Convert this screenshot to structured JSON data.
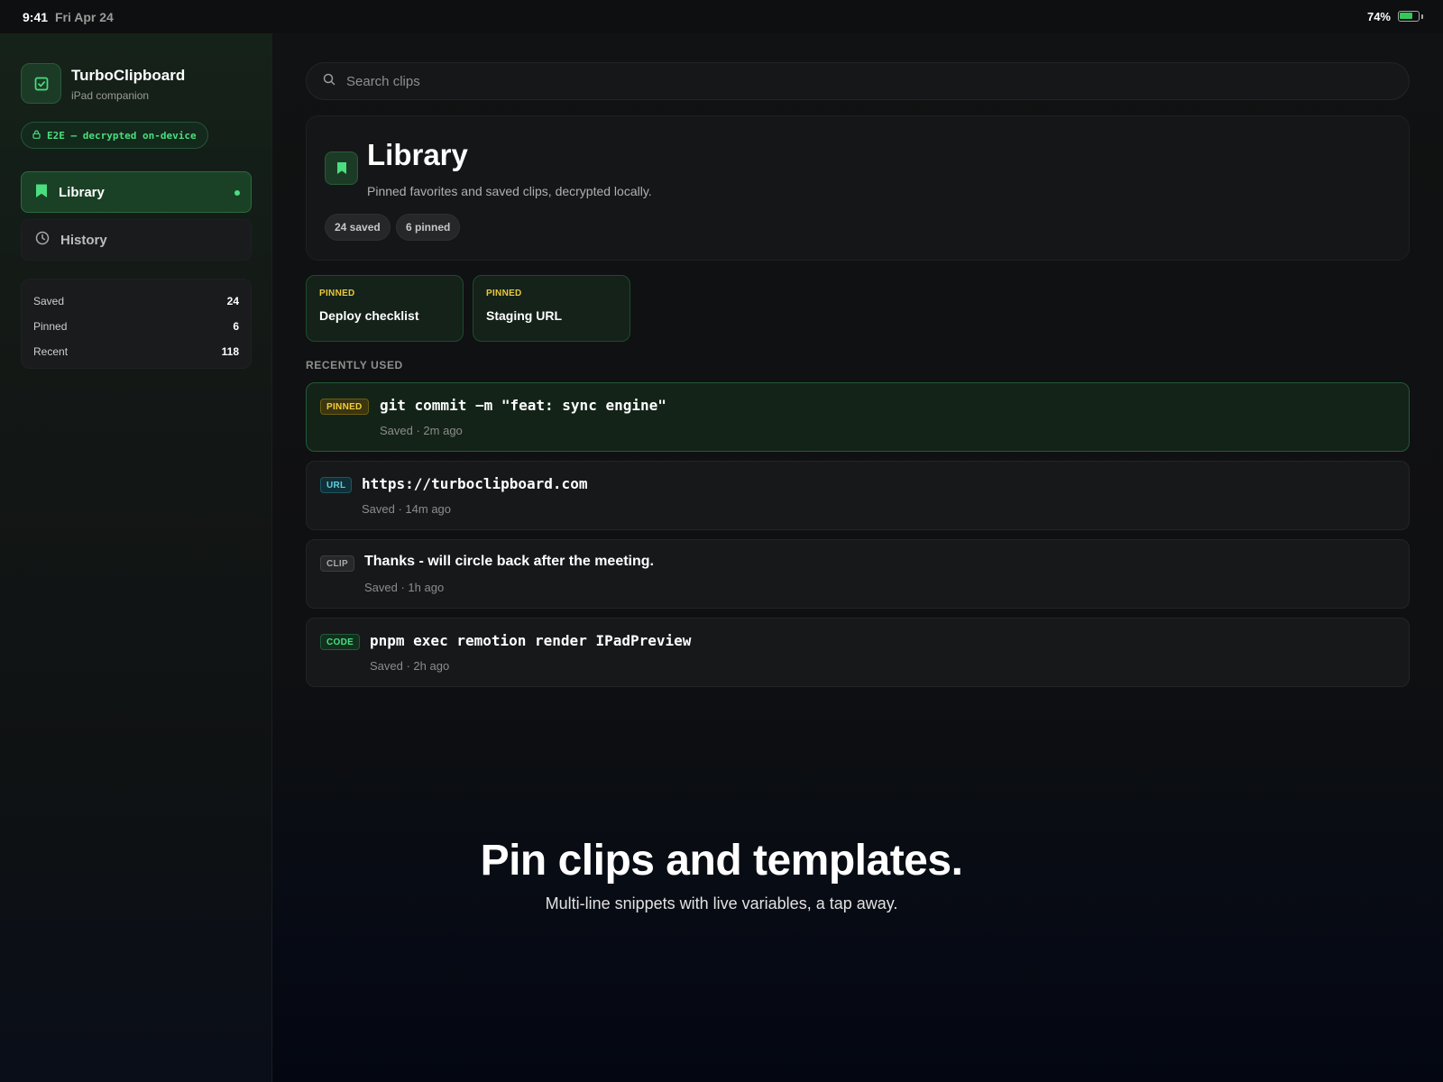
{
  "status_bar": {
    "time": "9:41",
    "date": "Fri Apr 24",
    "battery_text": "74%",
    "battery_level": 0.74,
    "battery_color": "#34c759"
  },
  "app": {
    "name": "TurboClipboard",
    "subtitle": "iPad companion",
    "icon": "clipboard-check-icon",
    "accent": "#4ade80"
  },
  "security_badge": {
    "label": "E2E — decrypted on-device",
    "icon": "lock-icon"
  },
  "sidebar": {
    "nav": [
      {
        "label": "Library",
        "icon": "bookmark-icon",
        "active": true
      },
      {
        "label": "History",
        "icon": "clock-icon",
        "active": false
      }
    ],
    "stats": [
      {
        "label": "Saved",
        "value": "24"
      },
      {
        "label": "Pinned",
        "value": "6"
      },
      {
        "label": "Recent",
        "value": "118"
      }
    ]
  },
  "search": {
    "placeholder": "Search clips",
    "icon": "search-icon"
  },
  "header": {
    "title": "Library",
    "subtitle": "Pinned favorites and saved clips, decrypted locally.",
    "icon": "bookmark-icon",
    "pills": [
      "24 saved",
      "6 pinned"
    ]
  },
  "pinned_cards": [
    {
      "tag": "PINNED",
      "title": "Deploy checklist"
    },
    {
      "tag": "PINNED",
      "title": "Staging URL"
    }
  ],
  "recent_section_label": "RECENTLY USED",
  "clips": [
    {
      "badge": "PINNED",
      "title": "git commit −m \"feat: sync engine\"",
      "meta": "Saved · 2m ago",
      "mono": true
    },
    {
      "badge": "URL",
      "title": "https://turboclipboard.com",
      "meta": "Saved · 14m ago",
      "mono": true
    },
    {
      "badge": "CLIP",
      "title": "Thanks - will circle back after the meeting.",
      "meta": "Saved · 1h ago",
      "mono": false
    },
    {
      "badge": "CODE",
      "title": "pnpm exec remotion render IPadPreview",
      "meta": "Saved · 2h ago",
      "mono": true
    }
  ],
  "marketing": {
    "headline": "Pin clips and templates.",
    "subline": "Multi-line snippets with live variables, a tap away."
  }
}
